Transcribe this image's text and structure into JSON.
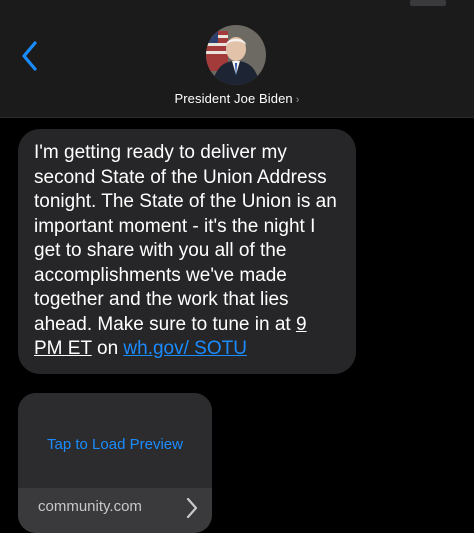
{
  "header": {
    "contact_name": "President Joe Biden",
    "back_icon": "chevron-left-icon",
    "avatar": "contact-avatar",
    "accent": "#1a8cff"
  },
  "message": {
    "text_before_time": "I'm getting ready to deliver my second State of the Union Address tonight. The State of the Union is an important moment - it's the night I get to share with you all of the accomplishments we've made together and the work that lies ahead. Make sure to tune in at ",
    "time": "9 PM ET",
    "text_between": " on ",
    "link": "wh.gov/ SOTU"
  },
  "preview": {
    "load_label": "Tap to Load Preview",
    "domain": "community.com"
  }
}
